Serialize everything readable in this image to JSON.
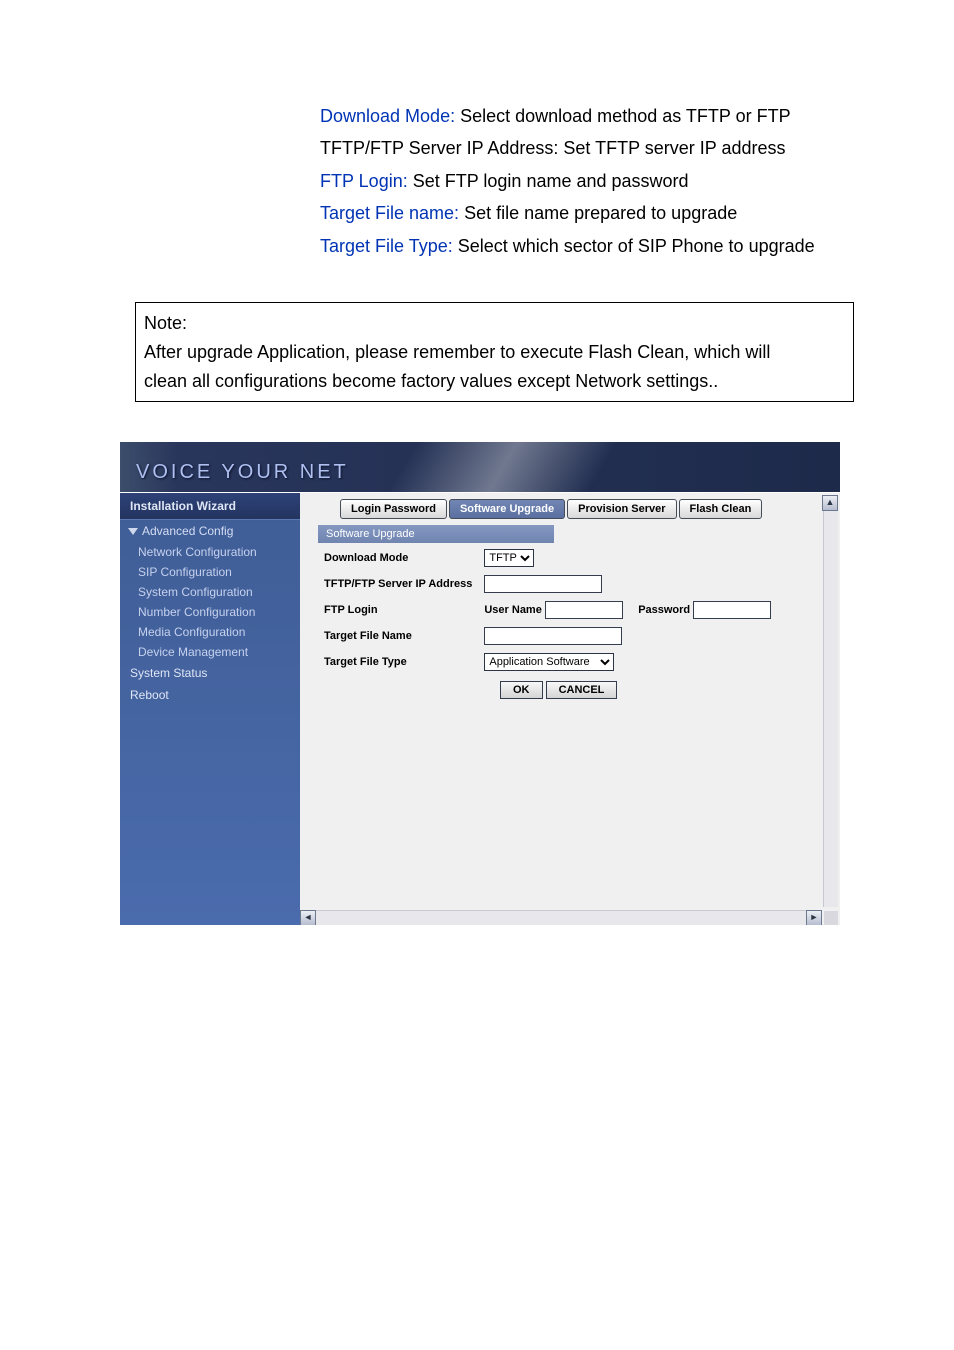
{
  "doc": {
    "download_mode_label": "Download Mode:",
    "download_mode_text": " Select download method as TFTP or FTP",
    "tftp_text": "TFTP/FTP Server IP Address: Set TFTP server IP address",
    "ftp_login_label": "FTP Login:",
    "ftp_login_text": " Set FTP login name and password",
    "target_file_name_label": "Target File name:",
    "target_file_name_text": " Set file name prepared to upgrade",
    "target_file_type_label": "Target File Type:",
    "target_file_type_text": " Select which sector of SIP Phone to upgrade"
  },
  "note": {
    "title": "Note:",
    "line1": "After upgrade Application, please remember to execute Flash Clean, which will",
    "line2": "clean all configurations become factory values except Network settings.."
  },
  "header": {
    "brand": "VOICE YOUR NET"
  },
  "sidebar": {
    "wizard": "Installation Wizard",
    "advanced": "Advanced Config",
    "items": [
      "Network Configuration",
      "SIP Configuration",
      "System Configuration",
      "Number Configuration",
      "Media Configuration",
      "Device Management"
    ],
    "status": "System Status",
    "reboot": "Reboot"
  },
  "tabs": {
    "login_password": "Login Password",
    "software_upgrade": "Software Upgrade",
    "provision_server": "Provision Server",
    "flash_clean": "Flash Clean"
  },
  "panel": {
    "title": "Software Upgrade",
    "download_mode": "Download Mode",
    "download_mode_value": "TFTP",
    "server_ip": "TFTP/FTP Server IP Address",
    "server_ip_value": "",
    "ftp_login": "FTP Login",
    "user_name_label": "User Name",
    "user_name_value": "",
    "password_label": "Password",
    "password_value": "",
    "target_file_name": "Target File Name",
    "target_file_name_value": "",
    "target_file_type": "Target File Type",
    "target_file_type_value": "Application Software",
    "ok": "OK",
    "cancel": "CANCEL"
  }
}
